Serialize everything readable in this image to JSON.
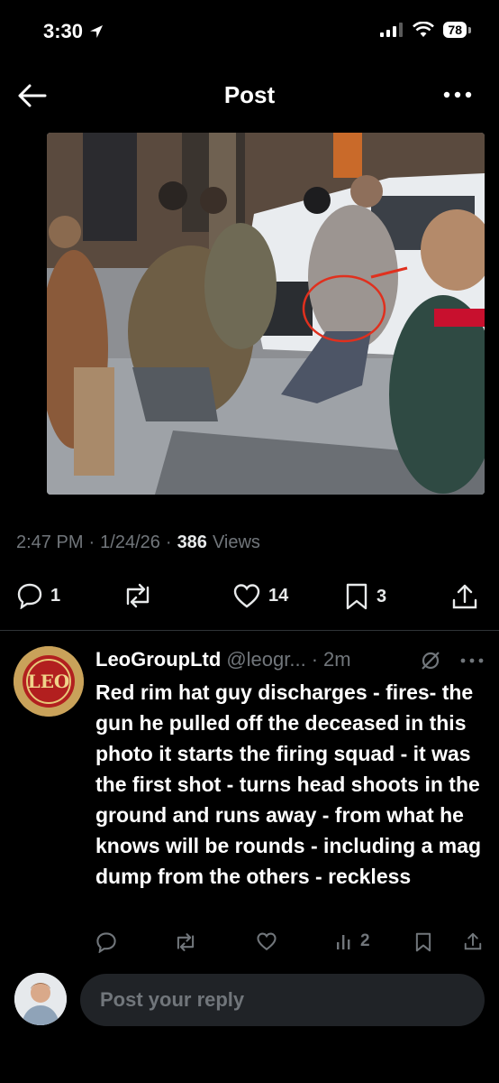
{
  "status_bar": {
    "time": "3:30",
    "battery": "78"
  },
  "header": {
    "title": "Post"
  },
  "post": {
    "time": "2:47 PM",
    "date": "1/24/26",
    "views_count": "386",
    "views_label": "Views",
    "replies": "1",
    "reposts": "",
    "likes": "14",
    "bookmarks": "3"
  },
  "reply": {
    "name": "LeoGroupLtd",
    "handle": "@leogr...",
    "time": "2m",
    "text": "Red rim hat guy discharges - fires- the gun he pulled off the deceased in this photo it starts the firing squad - it was the first shot - turns head shoots in the ground and runs away - from what he knows will be rounds - including a mag dump from the others -  reckless",
    "views": "2",
    "avatar_text": "LEO"
  },
  "composer": {
    "placeholder": "Post your reply"
  },
  "colors": {
    "background": "#000000",
    "muted": "#71767b",
    "text": "#e7e9ea",
    "annotation_red": "#e0301e"
  }
}
